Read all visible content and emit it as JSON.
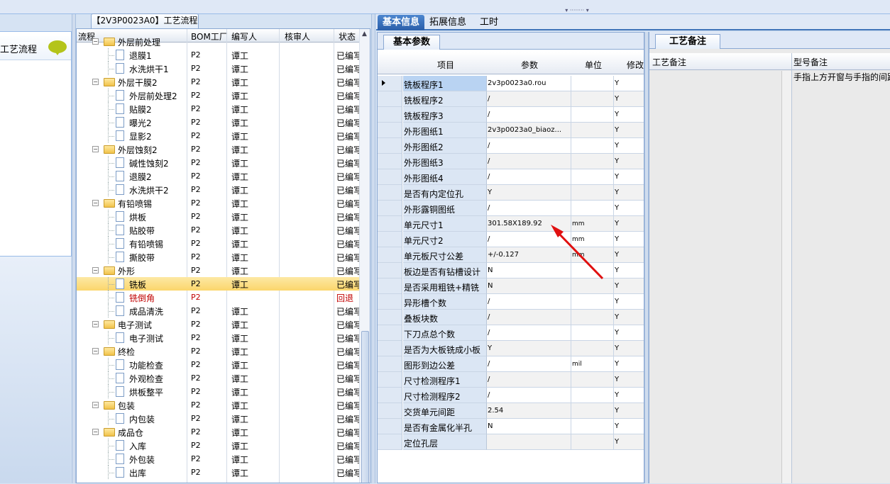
{
  "tree": {
    "tab_title": "【2V3P0023A0】工艺流程",
    "columns": {
      "flow": "流程",
      "bom": "BOM工厂",
      "writer": "编写人",
      "reviewer": "核审人",
      "status": "状态"
    },
    "rows": [
      {
        "name": "外层前处理",
        "level": 0,
        "type": "folder",
        "bom": "",
        "writer": "",
        "status": ""
      },
      {
        "name": "退膜1",
        "level": 1,
        "type": "file",
        "bom": "P2",
        "writer": "谭工",
        "status": "已编写"
      },
      {
        "name": "水洗烘干1",
        "level": 1,
        "type": "file",
        "bom": "P2",
        "writer": "谭工",
        "status": "已编写"
      },
      {
        "name": "外层干膜2",
        "level": 0,
        "type": "folder",
        "bom": "P2",
        "writer": "谭工",
        "status": "已编写"
      },
      {
        "name": "外层前处理2",
        "level": 1,
        "type": "file",
        "bom": "P2",
        "writer": "谭工",
        "status": "已编写"
      },
      {
        "name": "贴膜2",
        "level": 1,
        "type": "file",
        "bom": "P2",
        "writer": "谭工",
        "status": "已编写"
      },
      {
        "name": "曝光2",
        "level": 1,
        "type": "file",
        "bom": "P2",
        "writer": "谭工",
        "status": "已编写"
      },
      {
        "name": "显影2",
        "level": 1,
        "type": "file",
        "bom": "P2",
        "writer": "谭工",
        "status": "已编写"
      },
      {
        "name": "外层蚀刻2",
        "level": 0,
        "type": "folder",
        "bom": "P2",
        "writer": "谭工",
        "status": "已编写"
      },
      {
        "name": "碱性蚀刻2",
        "level": 1,
        "type": "file",
        "bom": "P2",
        "writer": "谭工",
        "status": "已编写"
      },
      {
        "name": "退膜2",
        "level": 1,
        "type": "file",
        "bom": "P2",
        "writer": "谭工",
        "status": "已编写"
      },
      {
        "name": "水洗烘干2",
        "level": 1,
        "type": "file",
        "bom": "P2",
        "writer": "谭工",
        "status": "已编写"
      },
      {
        "name": "有铅喷锡",
        "level": 0,
        "type": "folder",
        "bom": "P2",
        "writer": "谭工",
        "status": "已编写"
      },
      {
        "name": "烘板",
        "level": 1,
        "type": "file",
        "bom": "P2",
        "writer": "谭工",
        "status": "已编写"
      },
      {
        "name": "贴胶带",
        "level": 1,
        "type": "file",
        "bom": "P2",
        "writer": "谭工",
        "status": "已编写"
      },
      {
        "name": "有铅喷锡",
        "level": 1,
        "type": "file",
        "bom": "P2",
        "writer": "谭工",
        "status": "已编写"
      },
      {
        "name": "撕胶带",
        "level": 1,
        "type": "file",
        "bom": "P2",
        "writer": "谭工",
        "status": "已编写"
      },
      {
        "name": "外形",
        "level": 0,
        "type": "folder",
        "bom": "P2",
        "writer": "谭工",
        "status": "已编写"
      },
      {
        "name": "铣板",
        "level": 1,
        "type": "file",
        "bom": "P2",
        "writer": "谭工",
        "status": "已编写",
        "selected": true
      },
      {
        "name": "铣倒角",
        "level": 1,
        "type": "file",
        "bom": "P2",
        "writer": "",
        "status": "回退",
        "returned": true
      },
      {
        "name": "成品清洗",
        "level": 1,
        "type": "file",
        "bom": "P2",
        "writer": "谭工",
        "status": "已编写"
      },
      {
        "name": "电子测试",
        "level": 0,
        "type": "folder",
        "bom": "P2",
        "writer": "谭工",
        "status": "已编写"
      },
      {
        "name": "电子测试",
        "level": 1,
        "type": "file",
        "bom": "P2",
        "writer": "谭工",
        "status": "已编写"
      },
      {
        "name": "终检",
        "level": 0,
        "type": "folder",
        "bom": "P2",
        "writer": "谭工",
        "status": "已编写"
      },
      {
        "name": "功能检查",
        "level": 1,
        "type": "file",
        "bom": "P2",
        "writer": "谭工",
        "status": "已编写"
      },
      {
        "name": "外观检查",
        "level": 1,
        "type": "file",
        "bom": "P2",
        "writer": "谭工",
        "status": "已编写"
      },
      {
        "name": "烘板整平",
        "level": 1,
        "type": "file",
        "bom": "P2",
        "writer": "谭工",
        "status": "已编写"
      },
      {
        "name": "包装",
        "level": 0,
        "type": "folder",
        "bom": "P2",
        "writer": "谭工",
        "status": "已编写"
      },
      {
        "name": "内包装",
        "level": 1,
        "type": "file",
        "bom": "P2",
        "writer": "谭工",
        "status": "已编写"
      },
      {
        "name": "成品仓",
        "level": 0,
        "type": "folder",
        "bom": "P2",
        "writer": "谭工",
        "status": "已编写"
      },
      {
        "name": "入库",
        "level": 1,
        "type": "file",
        "bom": "P2",
        "writer": "谭工",
        "status": "已编写"
      },
      {
        "name": "外包装",
        "level": 1,
        "type": "file",
        "bom": "P2",
        "writer": "谭工",
        "status": "已编写"
      },
      {
        "name": "出库",
        "level": 1,
        "type": "file",
        "bom": "P2",
        "writer": "谭工",
        "status": "已编写"
      }
    ]
  },
  "left_nav": {
    "item_label": "工艺流程"
  },
  "main_tabs": [
    "基本信息",
    "拓展信息",
    "工时"
  ],
  "params": {
    "subtab": "基本参数",
    "columns": {
      "item": "项目",
      "param": "参数",
      "unit": "单位",
      "mod": "修改"
    },
    "rows": [
      {
        "item": "铣板程序1",
        "param": "2v3p0023a0.rou",
        "unit": "",
        "mod": "Y"
      },
      {
        "item": "铣板程序2",
        "param": "/",
        "unit": "",
        "mod": "Y"
      },
      {
        "item": "铣板程序3",
        "param": "/",
        "unit": "",
        "mod": "Y"
      },
      {
        "item": "外形图纸1",
        "param": "2v3p0023a0_biaoz...",
        "unit": "",
        "mod": "Y"
      },
      {
        "item": "外形图纸2",
        "param": "/",
        "unit": "",
        "mod": "Y"
      },
      {
        "item": "外形图纸3",
        "param": "/",
        "unit": "",
        "mod": "Y"
      },
      {
        "item": "外形图纸4",
        "param": "/",
        "unit": "",
        "mod": "Y"
      },
      {
        "item": "是否有内定位孔",
        "param": "Y",
        "unit": "",
        "mod": "Y"
      },
      {
        "item": "外形露铜图纸",
        "param": "/",
        "unit": "",
        "mod": "Y"
      },
      {
        "item": "单元尺寸1",
        "param": "301.58X189.92",
        "unit": "mm",
        "mod": "Y"
      },
      {
        "item": "单元尺寸2",
        "param": "/",
        "unit": "mm",
        "mod": "Y"
      },
      {
        "item": "单元板尺寸公差",
        "param": "+/-0.127",
        "unit": "mm",
        "mod": "Y"
      },
      {
        "item": "板边是否有钻槽设计",
        "param": "N",
        "unit": "",
        "mod": "Y"
      },
      {
        "item": "是否采用粗铣+精铣",
        "param": "N",
        "unit": "",
        "mod": "Y"
      },
      {
        "item": "异形槽个数",
        "param": "/",
        "unit": "",
        "mod": "Y"
      },
      {
        "item": "叠板块数",
        "param": "/",
        "unit": "",
        "mod": "Y"
      },
      {
        "item": "下刀点总个数",
        "param": "/",
        "unit": "",
        "mod": "Y"
      },
      {
        "item": "是否为大板铣成小板",
        "param": "Y",
        "unit": "",
        "mod": "Y"
      },
      {
        "item": "图形到边公差",
        "param": "/",
        "unit": "mil",
        "mod": "Y"
      },
      {
        "item": "尺寸检测程序1",
        "param": "/",
        "unit": "",
        "mod": "Y"
      },
      {
        "item": "尺寸检测程序2",
        "param": "/",
        "unit": "",
        "mod": "Y"
      },
      {
        "item": "交货单元间距",
        "param": "2.54",
        "unit": "",
        "mod": "Y"
      },
      {
        "item": "是否有金属化半孔",
        "param": "N",
        "unit": "",
        "mod": "Y"
      },
      {
        "item": "定位孔层",
        "param": "",
        "unit": "",
        "mod": "Y"
      }
    ]
  },
  "notes": {
    "subtab": "工艺备注",
    "col_process": "工艺备注",
    "col_model": "型号备注",
    "model_note_text": "手指上方开窗与手指的间距"
  },
  "annotation_color": "#e01010"
}
